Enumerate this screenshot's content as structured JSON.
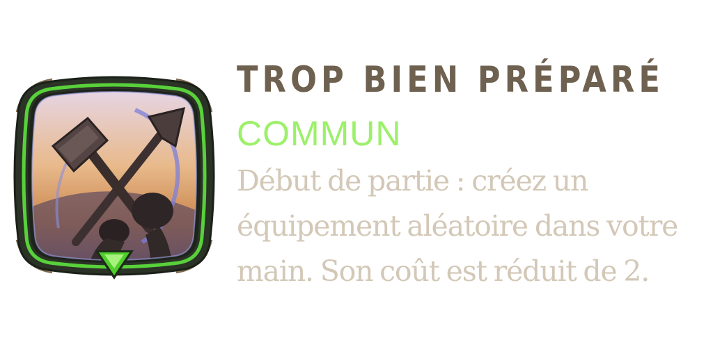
{
  "card": {
    "title": "TROP BIEN PRÉPARÉ",
    "rarity": "COMMUN",
    "description": "Début de partie : créez un équipement aléatoire dans votre main. Son coût est réduit de 2.",
    "icon": "crossed-hammer-axe-icon",
    "rarity_gem_icon": "green-triangle-gem-icon"
  },
  "colors": {
    "title": "#6f6150",
    "rarity": "#9cf06a",
    "description": "#d3c8b7",
    "frame_outer": "#2f3a2c",
    "frame_glow": "#5ed63a",
    "frame_accent": "#b7a583"
  }
}
